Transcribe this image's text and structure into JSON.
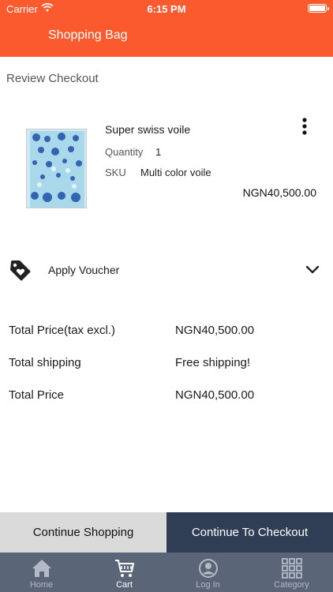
{
  "status_bar": {
    "carrier": "Carrier",
    "time": "6:15 PM"
  },
  "header": {
    "title": "Shopping Bag",
    "background": "#fb5a2e"
  },
  "section_title": "Review Checkout",
  "product": {
    "name": "Super swiss voile",
    "quantity_label": "Quantity",
    "quantity_value": "1",
    "sku_label": "SKU",
    "sku_value": "Multi color voile",
    "price": "NGN40,500.00",
    "image_icon": "fabric-image"
  },
  "voucher": {
    "label": "Apply Voucher",
    "icon": "tag-heart-icon",
    "toggle_icon": "chevron-down-icon"
  },
  "totals": [
    {
      "label": "Total Price(tax excl.)",
      "value": "NGN40,500.00"
    },
    {
      "label": "Total shipping",
      "value": "Free shipping!"
    },
    {
      "label": "Total Price",
      "value": "NGN40,500.00"
    }
  ],
  "actions": {
    "continue_shopping": "Continue Shopping",
    "continue_checkout": "Continue To Checkout"
  },
  "tabbar": {
    "items": [
      {
        "label": "Home",
        "icon": "home-icon"
      },
      {
        "label": "Cart",
        "icon": "cart-icon",
        "active": true
      },
      {
        "label": "Log In",
        "icon": "user-icon"
      },
      {
        "label": "Category",
        "icon": "grid-icon"
      }
    ]
  },
  "colors": {
    "accent": "#fb5a2e",
    "checkout_button": "#2f3e55",
    "tabbar": "#5a6578",
    "secondary_button": "#dadada"
  }
}
